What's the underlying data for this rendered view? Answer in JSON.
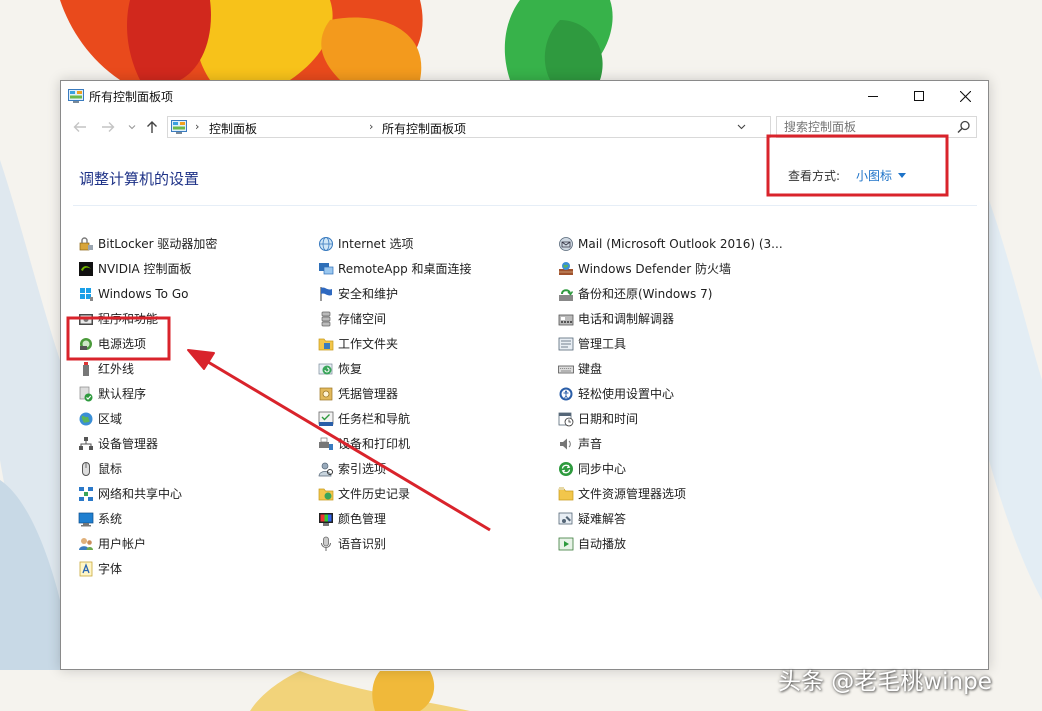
{
  "window": {
    "title": "所有控制面板项",
    "controls": {
      "minimize": "minimize-icon",
      "maximize": "maximize-icon",
      "close": "close-icon"
    }
  },
  "navigation": {
    "breadcrumbs": [
      "控制面板",
      "所有控制面板项"
    ],
    "search_placeholder": "搜索控制面板"
  },
  "header": {
    "title": "调整计算机的设置",
    "view_by_label": "查看方式:",
    "view_mode": "小图标"
  },
  "items": {
    "col1": [
      {
        "label": "BitLocker 驱动器加密",
        "icon": "bitlocker-icon"
      },
      {
        "label": "NVIDIA 控制面板",
        "icon": "nvidia-icon"
      },
      {
        "label": "Windows To Go",
        "icon": "windows-to-go-icon"
      },
      {
        "label": "程序和功能",
        "icon": "programs-icon"
      },
      {
        "label": "电源选项",
        "icon": "power-options-icon"
      },
      {
        "label": "红外线",
        "icon": "infrared-icon"
      },
      {
        "label": "默认程序",
        "icon": "default-programs-icon"
      },
      {
        "label": "区域",
        "icon": "region-icon"
      },
      {
        "label": "设备管理器",
        "icon": "device-manager-icon"
      },
      {
        "label": "鼠标",
        "icon": "mouse-icon"
      },
      {
        "label": "网络和共享中心",
        "icon": "network-icon"
      },
      {
        "label": "系统",
        "icon": "system-icon"
      },
      {
        "label": "用户帐户",
        "icon": "user-accounts-icon"
      },
      {
        "label": "字体",
        "icon": "fonts-icon"
      }
    ],
    "col2": [
      {
        "label": "Internet 选项",
        "icon": "internet-options-icon"
      },
      {
        "label": "RemoteApp 和桌面连接",
        "icon": "remoteapp-icon"
      },
      {
        "label": "安全和维护",
        "icon": "security-flag-icon"
      },
      {
        "label": "存储空间",
        "icon": "storage-spaces-icon"
      },
      {
        "label": "工作文件夹",
        "icon": "work-folders-icon"
      },
      {
        "label": "恢复",
        "icon": "recovery-icon"
      },
      {
        "label": "凭据管理器",
        "icon": "credential-manager-icon"
      },
      {
        "label": "任务栏和导航",
        "icon": "taskbar-icon"
      },
      {
        "label": "设备和打印机",
        "icon": "devices-printers-icon"
      },
      {
        "label": "索引选项",
        "icon": "indexing-icon"
      },
      {
        "label": "文件历史记录",
        "icon": "file-history-icon"
      },
      {
        "label": "颜色管理",
        "icon": "color-management-icon"
      },
      {
        "label": "语音识别",
        "icon": "speech-recognition-icon"
      }
    ],
    "col3": [
      {
        "label": "Mail (Microsoft Outlook 2016) (3...",
        "icon": "mail-icon"
      },
      {
        "label": "Windows Defender 防火墙",
        "icon": "firewall-icon"
      },
      {
        "label": "备份和还原(Windows 7)",
        "icon": "backup-icon"
      },
      {
        "label": "电话和调制解调器",
        "icon": "phone-modem-icon"
      },
      {
        "label": "管理工具",
        "icon": "admin-tools-icon"
      },
      {
        "label": "键盘",
        "icon": "keyboard-icon"
      },
      {
        "label": "轻松使用设置中心",
        "icon": "ease-of-access-icon"
      },
      {
        "label": "日期和时间",
        "icon": "date-time-icon"
      },
      {
        "label": "声音",
        "icon": "sound-icon"
      },
      {
        "label": "同步中心",
        "icon": "sync-center-icon"
      },
      {
        "label": "文件资源管理器选项",
        "icon": "explorer-options-icon"
      },
      {
        "label": "疑难解答",
        "icon": "troubleshooting-icon"
      },
      {
        "label": "自动播放",
        "icon": "autoplay-icon"
      }
    ]
  },
  "watermark": "头条 @老毛桃winpe",
  "colors": {
    "accent": "#1e73c8",
    "title_blue": "#1e3287",
    "annotation_red": "#d9232b"
  }
}
